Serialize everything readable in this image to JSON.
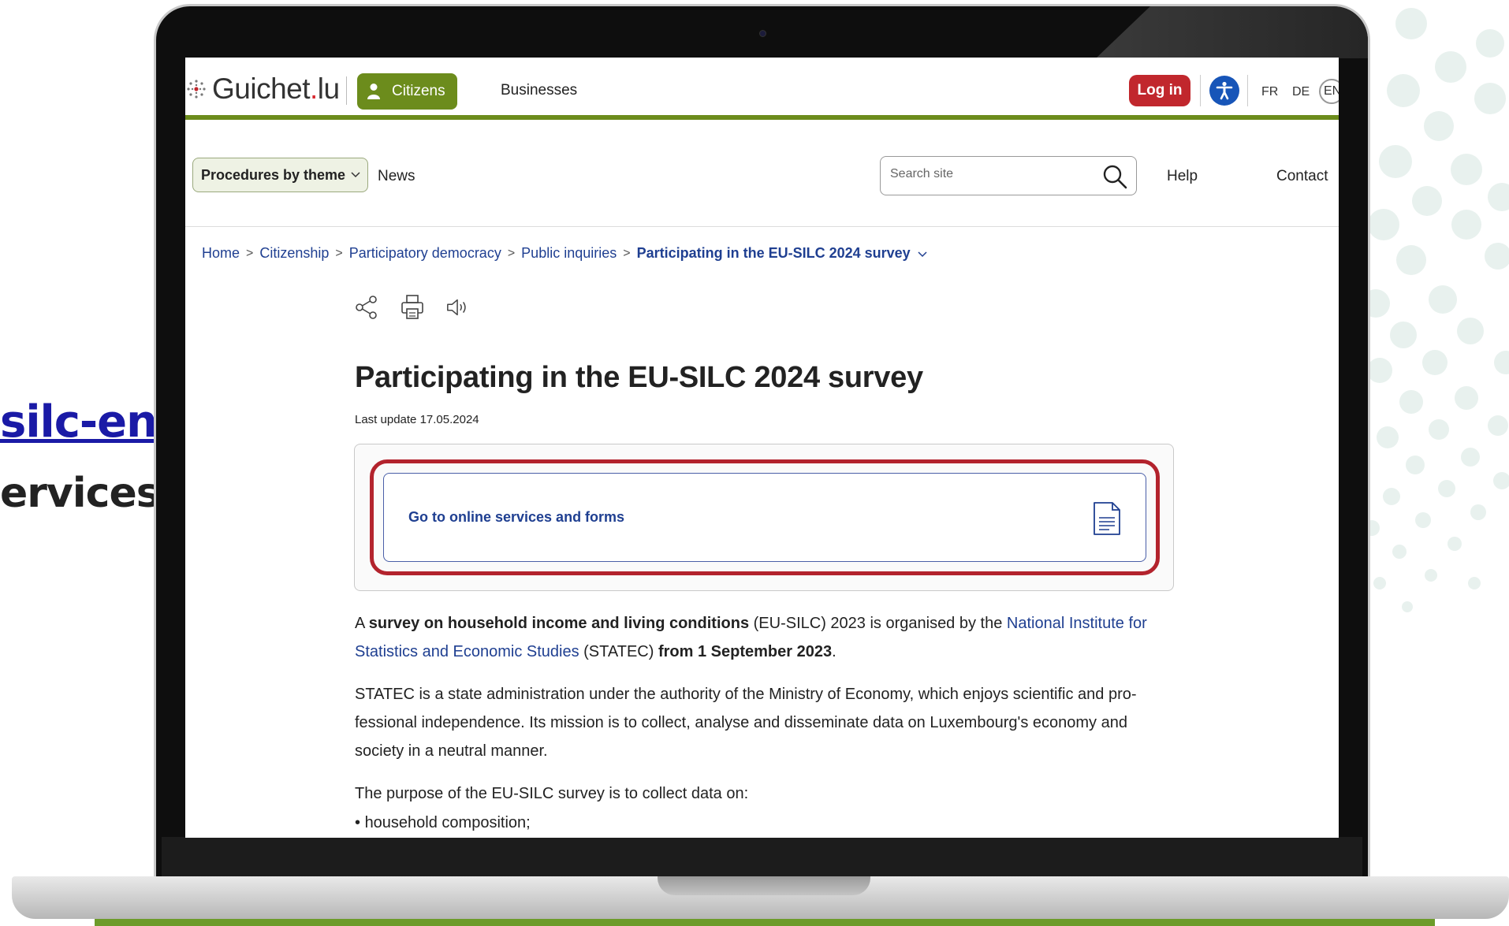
{
  "slide": {
    "fragment_link": "silc-en",
    "fragment_period": ".",
    "fragment_bold": "ervices"
  },
  "header": {
    "logo_name": "Guichet",
    "logo_dot": ".",
    "logo_tld": "lu",
    "citizens_label": "Citizens",
    "businesses_label": "Businesses",
    "login_label": "Log in",
    "languages": [
      "FR",
      "DE",
      "EN"
    ],
    "active_language": "EN"
  },
  "nav": {
    "procedures_label": "Procedures by theme",
    "news_label": "News",
    "search_placeholder": "Search site",
    "help_label": "Help",
    "contact_label": "Contact"
  },
  "breadcrumb": {
    "items": [
      "Home",
      "Citizenship",
      "Participatory democracy",
      "Public inquiries"
    ],
    "current": "Participating in the EU-SILC 2024 survey"
  },
  "article": {
    "title": "Participating in the EU-SILC 2024 survey",
    "last_update": "Last update 17.05.2024",
    "online_services_label": "Go to online services and forms",
    "p1": {
      "a": "A ",
      "b1": "survey on household income and living conditions",
      "c": " (EU-SILC) 2023 is organised by the ",
      "link": "National Institute for Statistics and Economic Studies",
      "d": " (STATEC) ",
      "b2": "from 1 September 2023",
      "e": "."
    },
    "p2": "STATEC is a state administration under the authority of the Ministry of Economy, which enjoys scientific and pro-fessional independence. Its mission is to collect, analyse and disseminate data on Luxembourg's economy and society in a neutral manner.",
    "p3": "The purpose of the EU-SILC survey is to collect data on:",
    "bullet_1": "household composition;"
  },
  "colors": {
    "brand_green": "#6c8c1c",
    "login_red": "#c1272d",
    "link_blue": "#1f3f91",
    "highlight_red": "#b3232d",
    "accessibility_blue": "#1755b8"
  },
  "icons": {
    "share": "share-icon",
    "print": "print-icon",
    "listen": "speaker-icon",
    "document": "document-icon",
    "search": "search-icon",
    "accessibility": "accessibility-icon",
    "user": "user-icon"
  }
}
